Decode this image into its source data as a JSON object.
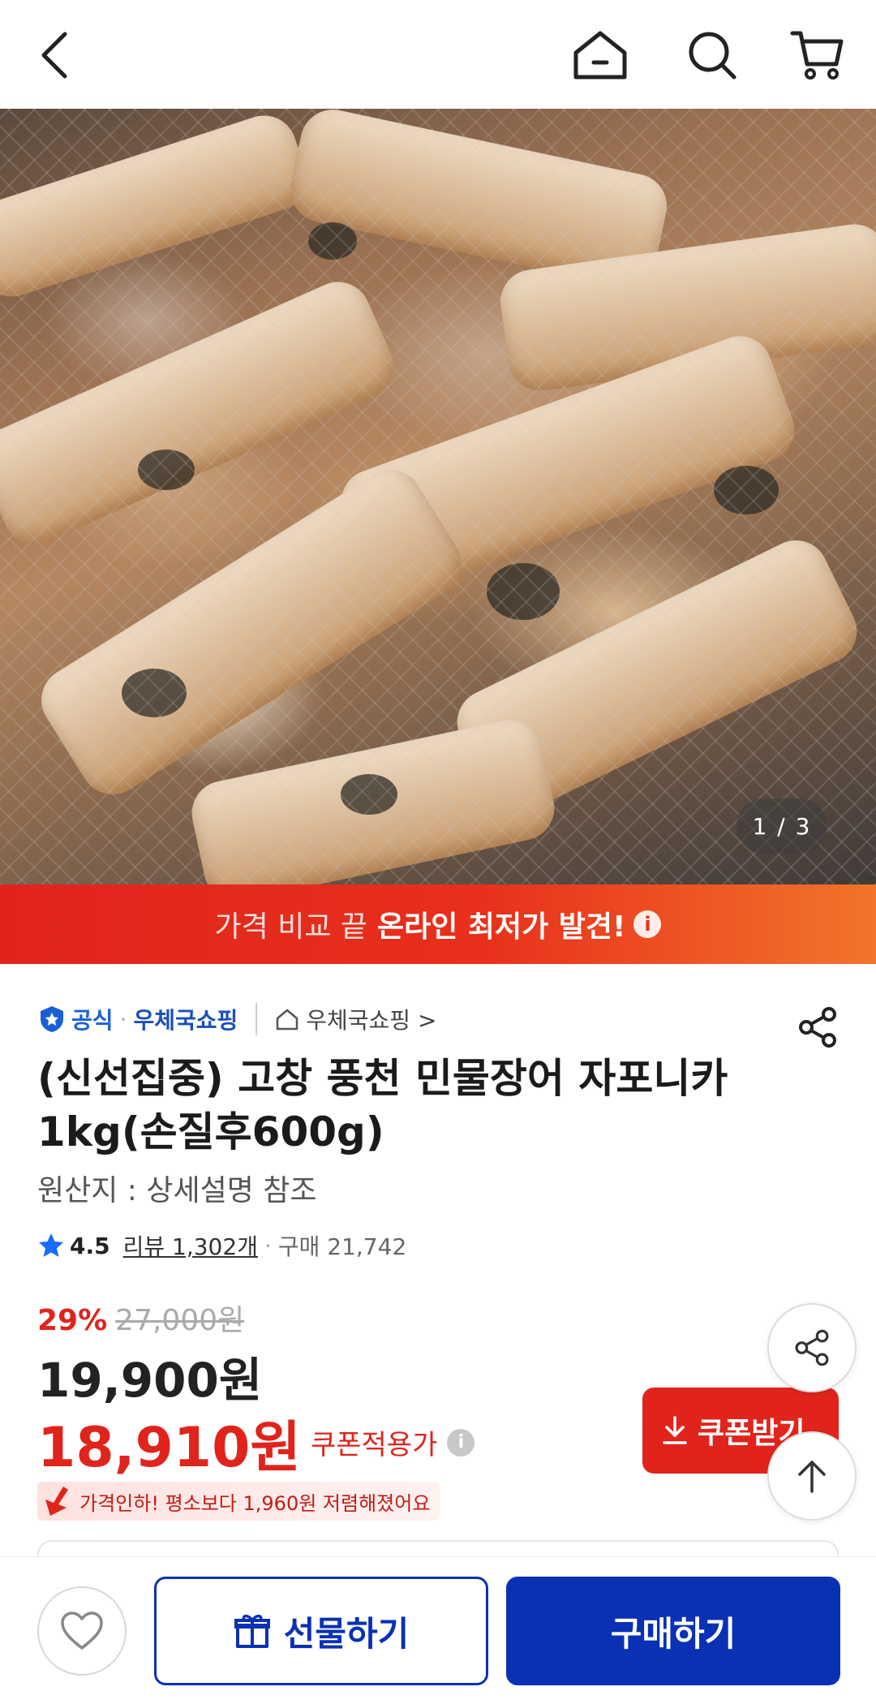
{
  "hero": {
    "pager": "1 / 3"
  },
  "banner": {
    "light_text": "가격 비교 끝",
    "bold_text": "온라인 최저가 발견!",
    "info_glyph": "i"
  },
  "seller": {
    "official": "공식",
    "dot": "·",
    "name": "우체국쇼핑",
    "store_link": "우체국쇼핑 >"
  },
  "product": {
    "title": "(신선집중) 고창 풍천 민물장어 자포니카 1kg(손질후600g)",
    "origin": "원산지 : 상세설명 참조"
  },
  "rating": {
    "score": "4.5",
    "reviews": "리뷰 1,302개",
    "sep": "·",
    "purchases": "구매 21,742"
  },
  "price": {
    "discount_pct": "29%",
    "original": "27,000원",
    "sale": "19,900원",
    "coupon_price": "18,910원",
    "coupon_label": "쿠폰적용가",
    "info_glyph": "i",
    "price_drop": "가격인하! 평소보다 1,960원 저렴해졌어요"
  },
  "coupon_button": {
    "label": "쿠폰받기"
  },
  "bottom": {
    "gift_label": "선물하기",
    "buy_label": "구매하기"
  },
  "colors": {
    "accent_red": "#e0241c",
    "brand_blue": "#0a31b3"
  }
}
